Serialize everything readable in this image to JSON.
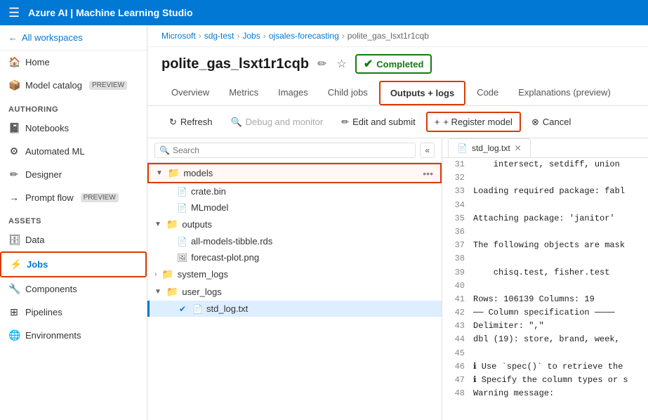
{
  "topbar": {
    "title": "Azure AI | Machine Learning Studio"
  },
  "breadcrumb": {
    "items": [
      "Microsoft",
      "sdg-test",
      "Jobs",
      "ojsales-forecasting",
      "polite_gas_lsxt1r1cqb"
    ]
  },
  "pageTitle": "polite_gas_lsxt1r1cqb",
  "statusBadge": "Completed",
  "tabs": [
    {
      "id": "overview",
      "label": "Overview"
    },
    {
      "id": "metrics",
      "label": "Metrics"
    },
    {
      "id": "images",
      "label": "Images"
    },
    {
      "id": "childjobs",
      "label": "Child jobs"
    },
    {
      "id": "outputslogs",
      "label": "Outputs + logs",
      "active": true,
      "highlighted": true
    },
    {
      "id": "code",
      "label": "Code"
    },
    {
      "id": "explanations",
      "label": "Explanations (preview)"
    }
  ],
  "toolbar": {
    "refresh": "Refresh",
    "debugMonitor": "Debug and monitor",
    "editSubmit": "Edit and submit",
    "registerModel": "+ Register model",
    "cancel": "Cancel"
  },
  "fileTree": {
    "searchPlaceholder": "Search",
    "nodes": [
      {
        "id": "models",
        "label": "models",
        "type": "folder-light",
        "level": 0,
        "expanded": true,
        "highlighted": true
      },
      {
        "id": "crate",
        "label": "crate.bin",
        "type": "file",
        "level": 2
      },
      {
        "id": "mlmodel",
        "label": "MLmodel",
        "type": "file",
        "level": 2
      },
      {
        "id": "outputs",
        "label": "outputs",
        "type": "folder-light",
        "level": 0,
        "expanded": true
      },
      {
        "id": "allmodels",
        "label": "all-models-tibble.rds",
        "type": "file",
        "level": 2
      },
      {
        "id": "forecastplot",
        "label": "forecast-plot.png",
        "type": "file",
        "level": 2
      },
      {
        "id": "systemlogs",
        "label": "system_logs",
        "type": "folder",
        "level": 0,
        "expanded": false
      },
      {
        "id": "userlogs",
        "label": "user_logs",
        "type": "folder-light",
        "level": 0,
        "expanded": true
      },
      {
        "id": "stdlogtxt",
        "label": "std_log.txt",
        "type": "file",
        "level": 2,
        "active": true
      }
    ]
  },
  "codeTab": {
    "filename": "std_log.txt",
    "lines": [
      {
        "num": 31,
        "text": "    intersect, setdiff, union"
      },
      {
        "num": 32,
        "text": ""
      },
      {
        "num": 33,
        "text": "Loading required package: fabl"
      },
      {
        "num": 34,
        "text": ""
      },
      {
        "num": 35,
        "text": "Attaching package: 'janitor'"
      },
      {
        "num": 36,
        "text": ""
      },
      {
        "num": 37,
        "text": "The following objects are mask"
      },
      {
        "num": 38,
        "text": ""
      },
      {
        "num": 39,
        "text": "    chisq.test, fisher.test"
      },
      {
        "num": 40,
        "text": ""
      },
      {
        "num": 41,
        "text": "Rows: 106139 Columns: 19"
      },
      {
        "num": 42,
        "text": "── Column specification ────"
      },
      {
        "num": 43,
        "text": "Delimiter: \",\""
      },
      {
        "num": 44,
        "text": "dbl (19): store, brand, week,"
      },
      {
        "num": 45,
        "text": ""
      },
      {
        "num": 46,
        "text": "ℹ Use `spec()` to retrieve the"
      },
      {
        "num": 47,
        "text": "ℹ Specify the column types or s"
      },
      {
        "num": 48,
        "text": "Warning message:"
      }
    ]
  },
  "sidebar": {
    "backLabel": "All workspaces",
    "nav": [
      {
        "id": "home",
        "label": "Home",
        "icon": "🏠"
      },
      {
        "id": "modelcatalog",
        "label": "Model catalog",
        "icon": "📦",
        "badge": "PREVIEW"
      }
    ],
    "authoring": {
      "label": "Authoring",
      "items": [
        {
          "id": "notebooks",
          "label": "Notebooks",
          "icon": "📓"
        },
        {
          "id": "automatedml",
          "label": "Automated ML",
          "icon": "⚙"
        },
        {
          "id": "designer",
          "label": "Designer",
          "icon": "✏"
        },
        {
          "id": "promptflow",
          "label": "Prompt flow",
          "icon": "→",
          "badge": "PREVIEW"
        }
      ]
    },
    "assets": {
      "label": "Assets",
      "items": [
        {
          "id": "data",
          "label": "Data",
          "icon": "🗄"
        },
        {
          "id": "jobs",
          "label": "Jobs",
          "icon": "⚡",
          "active": true
        },
        {
          "id": "components",
          "label": "Components",
          "icon": "🔧"
        },
        {
          "id": "pipelines",
          "label": "Pipelines",
          "icon": "⊞"
        },
        {
          "id": "environments",
          "label": "Environments",
          "icon": "🌐"
        }
      ]
    }
  }
}
